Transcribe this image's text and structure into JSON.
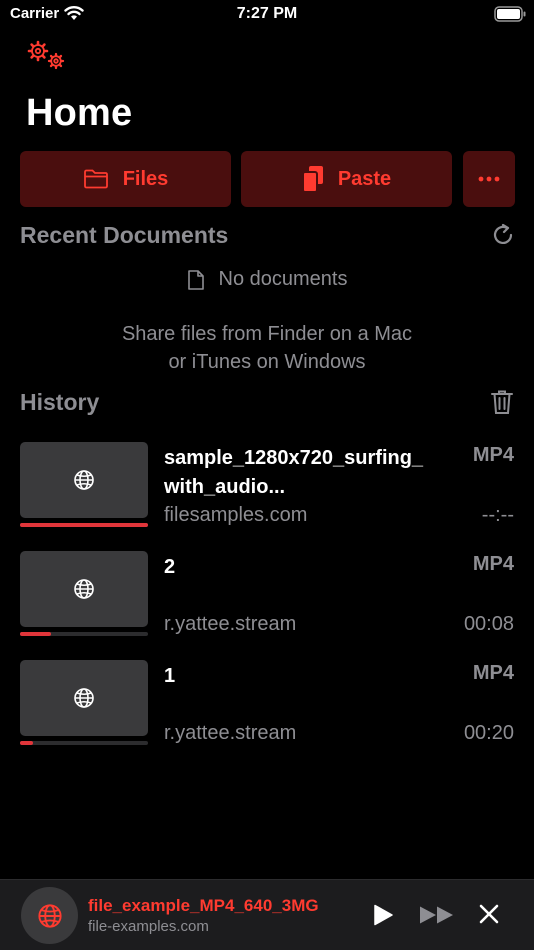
{
  "status_bar": {
    "carrier": "Carrier",
    "time": "7:27 PM"
  },
  "page_title": "Home",
  "actions": {
    "files_label": "Files",
    "paste_label": "Paste"
  },
  "recent": {
    "title": "Recent Documents",
    "empty_label": "No documents",
    "hint_line1": "Share files from Finder on a Mac",
    "hint_line2": "or iTunes on Windows"
  },
  "history": {
    "title": "History",
    "items": [
      {
        "title": "sample_1280x720_surfing_\nwith_audio...",
        "format": "MP4",
        "source": "filesamples.com",
        "duration": "--:--",
        "progress": 1.0
      },
      {
        "title": "2",
        "format": "MP4",
        "source": "r.yattee.stream",
        "duration": "00:08",
        "progress": 0.24
      },
      {
        "title": "1",
        "format": "MP4",
        "source": "r.yattee.stream",
        "duration": "00:20",
        "progress": 0.1
      }
    ]
  },
  "now_playing": {
    "title": "file_example_MP4_640_3MG",
    "source": "file-examples.com"
  },
  "colors": {
    "accent": "#ff3b30",
    "button_bg": "#4a0e0e",
    "secondary_text": "#8e8e93",
    "progress": "#e0353a"
  },
  "icons": [
    "wifi-icon",
    "battery-icon",
    "gear-icon",
    "folder-icon",
    "paste-icon",
    "ellipsis-icon",
    "refresh-icon",
    "document-icon",
    "trash-icon",
    "globe-icon",
    "play-icon",
    "fast-forward-icon",
    "close-icon"
  ]
}
